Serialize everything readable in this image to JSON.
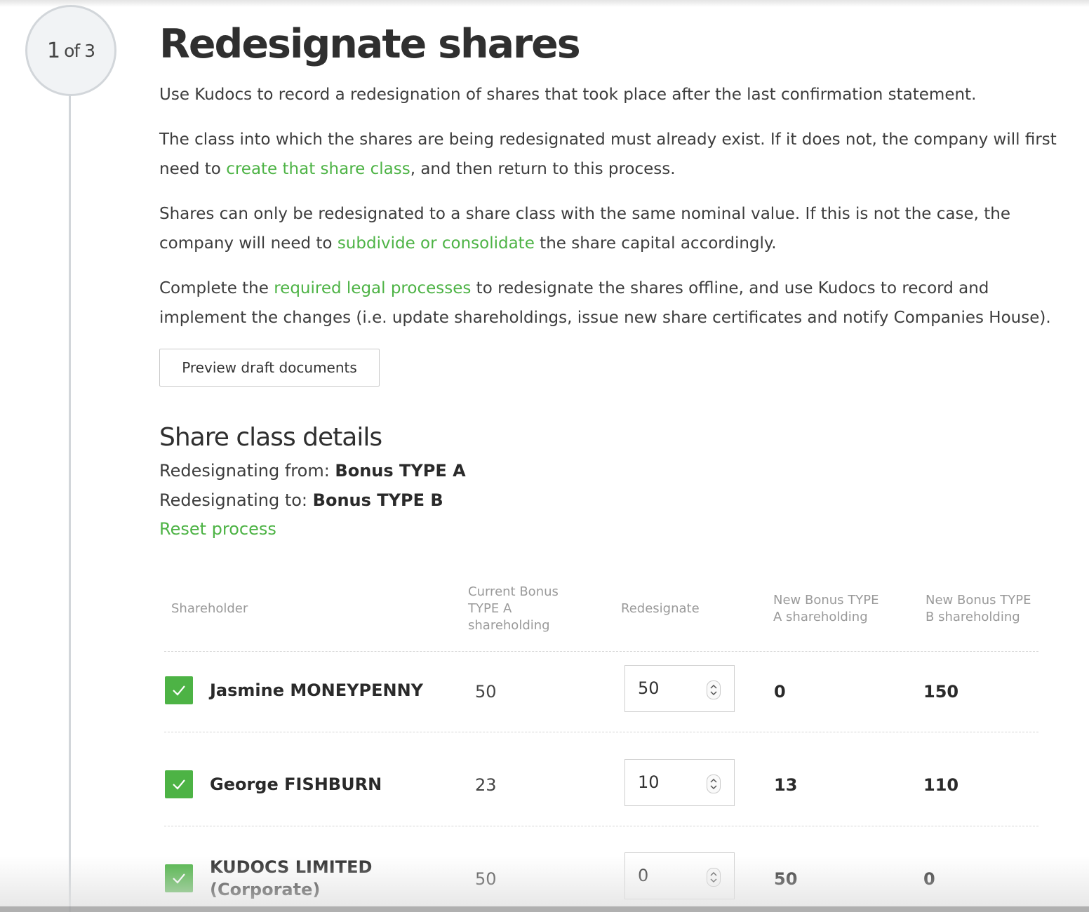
{
  "step": {
    "current": "1",
    "of_text": "of 3"
  },
  "header": {
    "title": "Redesignate shares"
  },
  "intro": {
    "p1": "Use Kudocs to record a redesignation of shares that took place after the last confirmation statement.",
    "p2_before": "The class into which the shares are being redesignated must already exist. If it does not, the company will first need to ",
    "p2_link": "create that share class",
    "p2_after": ", and then return to this process.",
    "p3_before": "Shares can only be redesignated to a share class with the same nominal value. If this is not the case, the company will need to ",
    "p3_link": "subdivide or consolidate",
    "p3_after": " the share capital accordingly.",
    "p4_before": "Complete the ",
    "p4_link": "required legal processes",
    "p4_after": " to redesignate the shares offline, and use Kudocs to record and implement the changes (i.e. update shareholdings, issue new share certificates and notify Companies House)."
  },
  "actions": {
    "preview_label": "Preview draft documents"
  },
  "share_class": {
    "heading": "Share class details",
    "from_label": "Redesignating from:",
    "from_value": "Bonus TYPE A",
    "to_label": "Redesignating to:",
    "to_value": "Bonus TYPE B",
    "reset_label": "Reset process"
  },
  "table": {
    "headers": {
      "shareholder": "Shareholder",
      "current": "Current Bonus TYPE A shareholding",
      "redesignate": "Redesignate",
      "new_a": "New Bonus TYPE A shareholding",
      "new_b": "New Bonus TYPE B shareholding"
    },
    "rows": [
      {
        "name": "Jasmine MONEYPENNY",
        "current": "50",
        "redesignate": "50",
        "new_a": "0",
        "new_b": "150",
        "checked": true
      },
      {
        "name": "George FISHBURN",
        "current": "23",
        "redesignate": "10",
        "new_a": "13",
        "new_b": "110",
        "checked": true
      },
      {
        "name": "KUDOCS LIMITED (Corporate)",
        "current": "50",
        "redesignate": "0",
        "new_a": "50",
        "new_b": "0",
        "checked": true
      }
    ]
  },
  "colors": {
    "accent": "#4db345",
    "text": "#333333",
    "muted": "#9a9a9a"
  }
}
